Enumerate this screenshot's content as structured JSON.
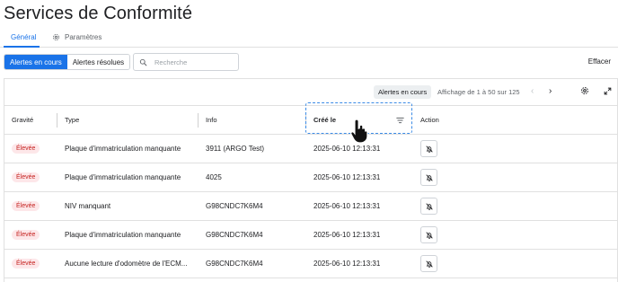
{
  "page_title": "Services de Conformité",
  "tabs": [
    {
      "label": "Général",
      "active": true
    },
    {
      "label": "Paramètres",
      "active": false
    }
  ],
  "toolbar": {
    "segment": [
      {
        "label": "Alertes en cours",
        "active": true
      },
      {
        "label": "Alertes résolues",
        "active": false
      }
    ],
    "search_placeholder": "Recherche",
    "search_value": "",
    "clear_label": "Effacer"
  },
  "grid_header": {
    "filter_chip": "Alertes en cours",
    "pagination": "Affichage de 1 à 50 sur 125"
  },
  "table": {
    "columns": [
      "Gravité",
      "Type",
      "Info",
      "Créé le",
      "Action"
    ],
    "rows": [
      {
        "severity": "Élevée",
        "type": "Plaque d'immatriculation manquante",
        "info": "3911 (ARGO Test)",
        "created": "2025-06-10 12:13:31"
      },
      {
        "severity": "Élevée",
        "type": "Plaque d'immatriculation manquante",
        "info": "4025",
        "created": "2025-06-10 12:13:31"
      },
      {
        "severity": "Élevée",
        "type": "NIV manquant",
        "info": "G98CNDC7K6M4",
        "created": "2025-06-10 12:13:31"
      },
      {
        "severity": "Élevée",
        "type": "Plaque d'immatriculation manquante",
        "info": "G98CNDC7K6M4",
        "created": "2025-06-10 12:13:31"
      },
      {
        "severity": "Élevée",
        "type": "Aucune lecture d'odomètre de l'ECM...",
        "info": "G98CNDC7K6M4",
        "created": "2025-06-10 12:13:31"
      }
    ]
  },
  "colors": {
    "accent": "#1a73e8",
    "badge_bg": "#fde7e9",
    "badge_text": "#c5221f",
    "highlight": "#3b8be6"
  },
  "icons": [
    "gear-icon",
    "search-icon",
    "chevron-left-icon",
    "chevron-right-icon",
    "expand-icon",
    "sort-icon",
    "bell-off-icon",
    "hand-cursor-icon"
  ]
}
